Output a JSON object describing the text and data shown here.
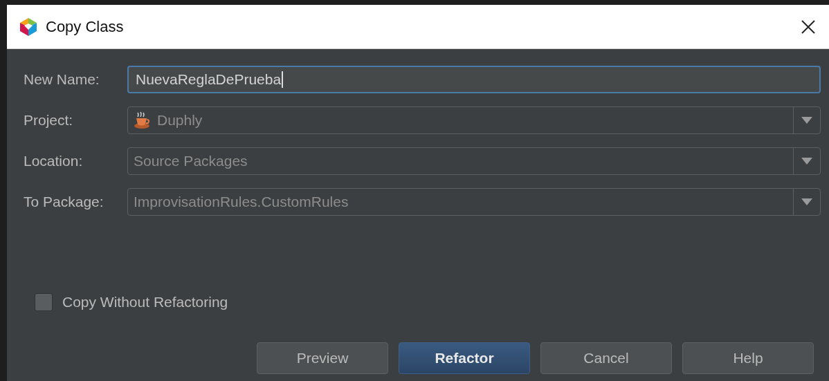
{
  "window": {
    "title": "Copy Class"
  },
  "fields": [
    {
      "kind": "text",
      "label": "New Name:",
      "value": "NuevaReglaDePrueba",
      "focused": true
    },
    {
      "kind": "combo",
      "label": "Project:",
      "value": "Duphly",
      "has_icon": true
    },
    {
      "kind": "combo",
      "label": "Location:",
      "value": "Source Packages",
      "has_icon": false
    },
    {
      "kind": "combo",
      "label": "To Package:",
      "value": "ImprovisationRules.CustomRules",
      "has_icon": false
    }
  ],
  "checkbox": {
    "label": "Copy Without Refactoring",
    "checked": false
  },
  "buttons": [
    {
      "label": "Preview",
      "default": false
    },
    {
      "label": "Refactor",
      "default": true
    },
    {
      "label": "Cancel",
      "default": false
    },
    {
      "label": "Help",
      "default": false
    }
  ]
}
